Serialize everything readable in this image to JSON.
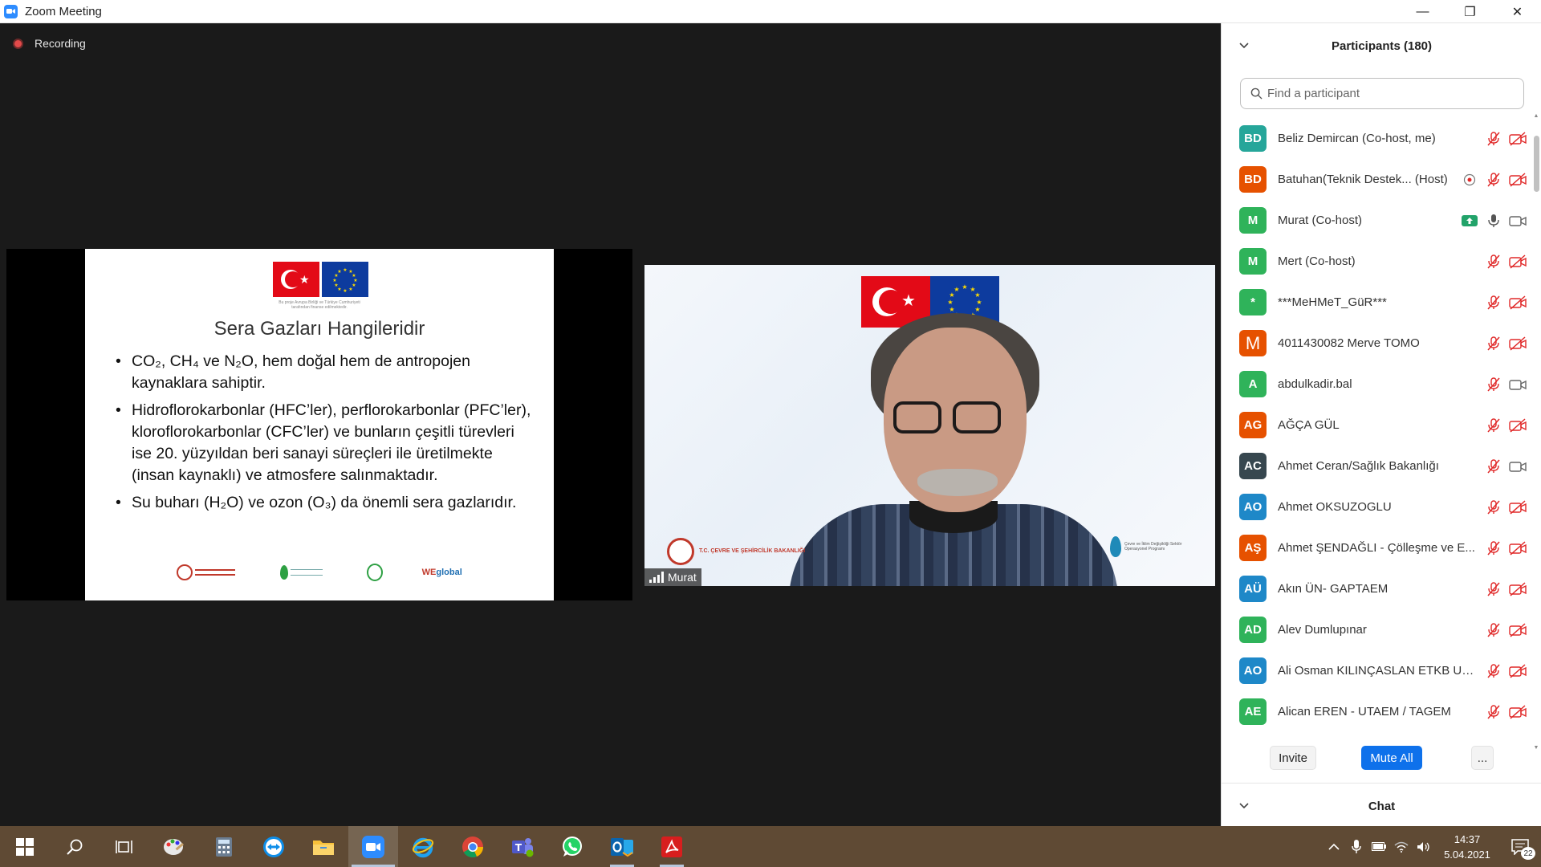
{
  "window": {
    "title": "Zoom Meeting",
    "minimize": "—",
    "restore": "❐",
    "close": "✕"
  },
  "meeting": {
    "recording_label": "Recording"
  },
  "slide": {
    "title": "Sera Gazları Hangileridir",
    "funding_caption": "Bu proje Avrupa Birliği ve Türkiye Cumhuriyeti tarafından finanse edilmektedir.",
    "bullets": [
      "CO₂, CH₄ ve N₂O, hem doğal hem de antropojen kaynaklara sahiptir.",
      "Hidroflorokarbonlar (HFC’ler), perflorokarbonlar (PFC’ler), kloroflorokarbonlar (CFC’ler) ve bunların çeşitli türevleri ise 20. yüzyıldan beri sanayi süreçleri ile üretilmekte (insan kaynaklı) ve atmosfere salınmaktadır.",
      "Su buharı (H₂O) ve ozon (O₃) da önemli sera gazlarıdır."
    ],
    "logo_ministry": "T.C. ÇEVRE VE ŞEHİRCİLİK BAKANLIĞI",
    "logo_we": "WE",
    "logo_global": "global"
  },
  "video": {
    "participant_name": "Murat",
    "logo_left_text": "T.C. ÇEVRE VE ŞEHİRCİLİK BAKANLIĞI",
    "logo_right_text": "Çevre ve İklim Değişikliği Sektör Operasyonel Programı",
    "flag_caption": "Bu proje A"
  },
  "participants": {
    "title": "Participants (180)",
    "search_placeholder": "Find a participant",
    "list": [
      {
        "initials": "BD",
        "color": "#26a69a",
        "name": "Beliz Demircan (Co-host, me)",
        "mic": "muted",
        "video": "off"
      },
      {
        "initials": "BD",
        "color": "#e65100",
        "name": "Batuhan(Teknik Destek... (Host)",
        "mic": "muted",
        "video": "off",
        "recording": true
      },
      {
        "initials": "M",
        "color": "#2fb35a",
        "name": "Murat (Co-host)",
        "mic": "on",
        "video": "on",
        "sharing": true
      },
      {
        "initials": "M",
        "color": "#2fb35a",
        "name": "Mert (Co-host)",
        "mic": "muted",
        "video": "off"
      },
      {
        "initials": "*",
        "color": "#2fb35a",
        "name": "***MeHMeT_GüR***",
        "mic": "muted",
        "video": "off"
      },
      {
        "initials": "M",
        "color": "#e65100",
        "name": "4011430082 Merve TOMO",
        "mic": "muted",
        "video": "off",
        "big": true
      },
      {
        "initials": "A",
        "color": "#2fb35a",
        "name": "abdulkadir.bal",
        "mic": "muted",
        "video": "on"
      },
      {
        "initials": "AG",
        "color": "#e65100",
        "name": "AĞÇA GÜL",
        "mic": "muted",
        "video": "off"
      },
      {
        "initials": "AC",
        "color": "#37474f",
        "name": "Ahmet Ceran/Sağlık Bakanlığı",
        "mic": "muted",
        "video": "on"
      },
      {
        "initials": "AO",
        "color": "#1e88c8",
        "name": "Ahmet OKSUZOGLU",
        "mic": "muted",
        "video": "off"
      },
      {
        "initials": "AŞ",
        "color": "#e65100",
        "name": "Ahmet ŞENDAĞLI - Çölleşme ve E...",
        "mic": "muted",
        "video": "off"
      },
      {
        "initials": "AÜ",
        "color": "#1e88c8",
        "name": "Akın ÜN- GAPTAEM",
        "mic": "muted",
        "video": "off"
      },
      {
        "initials": "AD",
        "color": "#2fb35a",
        "name": "Alev Dumlupınar",
        "mic": "muted",
        "video": "off"
      },
      {
        "initials": "AO",
        "color": "#1e88c8",
        "name": "Ali Osman KILINÇASLAN ETKB Uz...",
        "mic": "muted",
        "video": "off"
      },
      {
        "initials": "AE",
        "color": "#2fb35a",
        "name": "Alican EREN - UTAEM / TAGEM",
        "mic": "muted",
        "video": "off"
      }
    ],
    "invite_label": "Invite",
    "mute_all_label": "Mute All",
    "more_label": "..."
  },
  "chat": {
    "title": "Chat"
  },
  "taskbar": {
    "apps": [
      "windows-start",
      "search",
      "task-view",
      "paint",
      "calculator",
      "teamviewer",
      "file-explorer",
      "zoom",
      "internet-explorer",
      "chrome",
      "teams",
      "whatsapp",
      "outlook",
      "acrobat"
    ],
    "time": "14:37",
    "date": "5.04.2021",
    "notification_count": "22"
  }
}
